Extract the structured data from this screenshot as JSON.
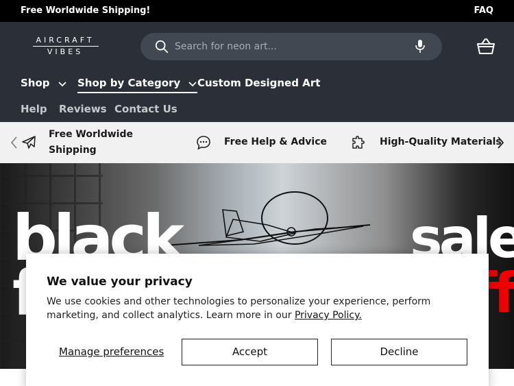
{
  "announcement": {
    "left_text": "Free Worldwide Shipping!",
    "right_link": "FAQ"
  },
  "header": {
    "logo_line1": "AIRCRAFT",
    "logo_line2": "VIBES",
    "search_placeholder": "Search for neon art...",
    "icons": {
      "search": "search-icon",
      "mic": "microphone-icon",
      "cart": "basket-icon"
    }
  },
  "nav": {
    "primary": [
      {
        "label": "Shop",
        "has_dropdown": true
      },
      {
        "label": "Shop by Category",
        "has_dropdown": true,
        "active": true
      },
      {
        "label": "Custom Designed Art",
        "has_dropdown": false
      }
    ],
    "secondary": [
      {
        "label": "Help"
      },
      {
        "label": "Reviews"
      },
      {
        "label": "Contact Us"
      }
    ]
  },
  "benefits": {
    "items": [
      {
        "label_line1": "Free Worldwide",
        "label_line2": "Shipping",
        "icon": "airplane-icon"
      },
      {
        "label": "Free Help & Advice",
        "icon": "chat-bubble-icon"
      },
      {
        "label": "High-Quality Materials",
        "icon": "puzzle-piece-icon"
      }
    ]
  },
  "hero": {
    "word1": "black",
    "word2": "sale",
    "word3": "f",
    "word4": "ff"
  },
  "cookie": {
    "title": "We value your privacy",
    "body": "We use cookies and other technologies to personalize your experience, perform marketing, and collect analytics. Learn more in our ",
    "policy_link": "Privacy Policy.",
    "manage_label": "Manage preferences",
    "accept_label": "Accept",
    "decline_label": "Decline"
  },
  "colors": {
    "header_bg": "#2b3038",
    "search_bg": "#424851",
    "announce_bg": "#000000",
    "strip_bg": "#f1f1f1",
    "sale_red": "#e00000"
  }
}
